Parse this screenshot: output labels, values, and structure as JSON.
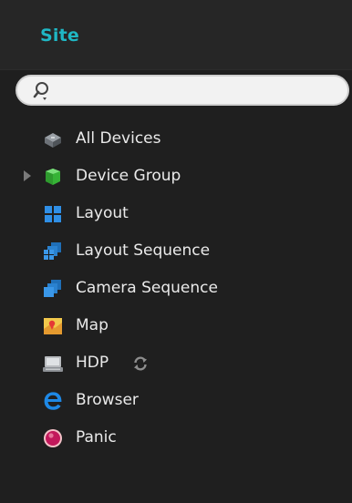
{
  "header": {
    "title": "Site"
  },
  "search": {
    "value": "",
    "placeholder": ""
  },
  "tree": {
    "items": [
      {
        "label": "All Devices",
        "icon": "all-devices-icon"
      },
      {
        "label": "Device Group",
        "icon": "device-group-icon",
        "expandable": true
      },
      {
        "label": "Layout",
        "icon": "layout-icon"
      },
      {
        "label": "Layout Sequence",
        "icon": "layout-sequence-icon"
      },
      {
        "label": "Camera Sequence",
        "icon": "camera-sequence-icon"
      },
      {
        "label": "Map",
        "icon": "map-icon"
      },
      {
        "label": "HDP",
        "icon": "hdp-icon",
        "badge_icon": "sync-icon"
      },
      {
        "label": "Browser",
        "icon": "browser-icon"
      },
      {
        "label": "Panic",
        "icon": "panic-icon"
      }
    ]
  },
  "colors": {
    "background": "#1f1f1f",
    "header_background": "#262626",
    "title": "#1fb7c4",
    "text": "#eaeaea"
  }
}
